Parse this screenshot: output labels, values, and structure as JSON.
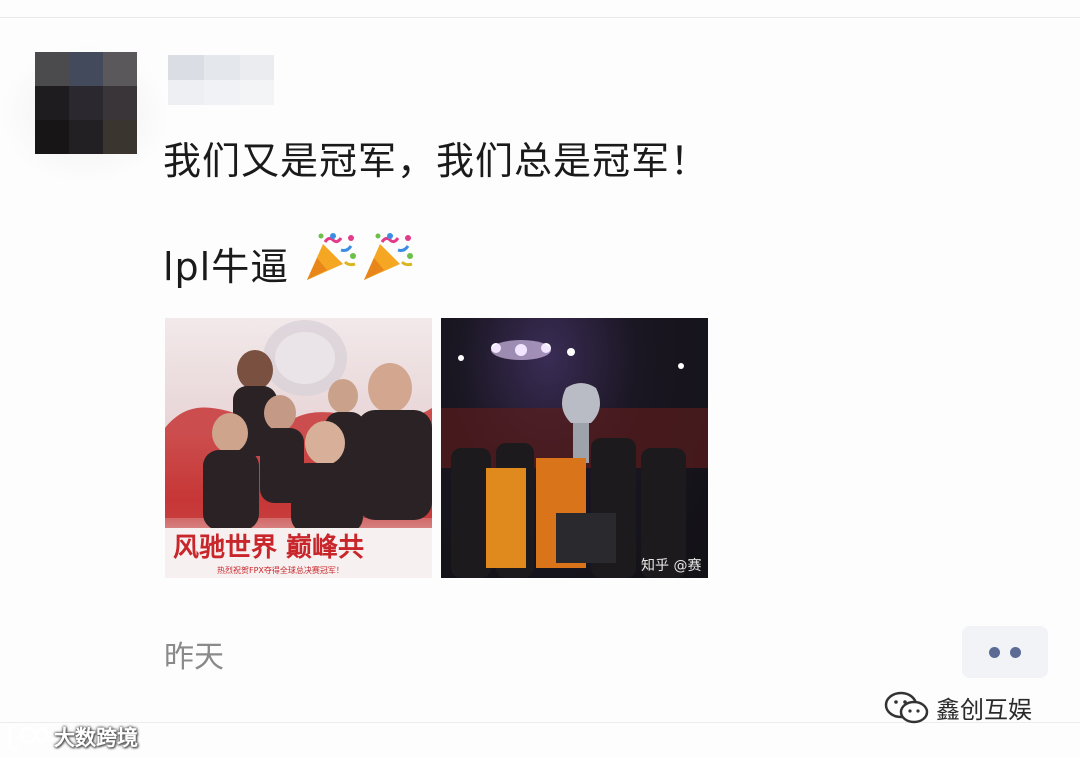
{
  "post": {
    "line1": "我们又是冠军，我们总是冠军！",
    "line2_text": "lpl牛逼",
    "emoji": [
      "party-popper-icon",
      "party-popper-icon"
    ],
    "timestamp": "昨天"
  },
  "images": [
    {
      "caption": "风驰世界 巅峰共",
      "subcaption": "热烈祝贺FPX夺得全球总决赛冠军！"
    },
    {
      "caption": "知乎 @赛"
    }
  ],
  "more_button": {
    "icon": "more-dots-icon"
  },
  "watermarks": {
    "right": "鑫创互娱",
    "left": "大数跨境"
  },
  "colors": {
    "text": "#1a1a1a",
    "timestamp": "#8a8a8a",
    "more_dots": "#5b6b94",
    "more_bg": "#f2f3f7"
  }
}
